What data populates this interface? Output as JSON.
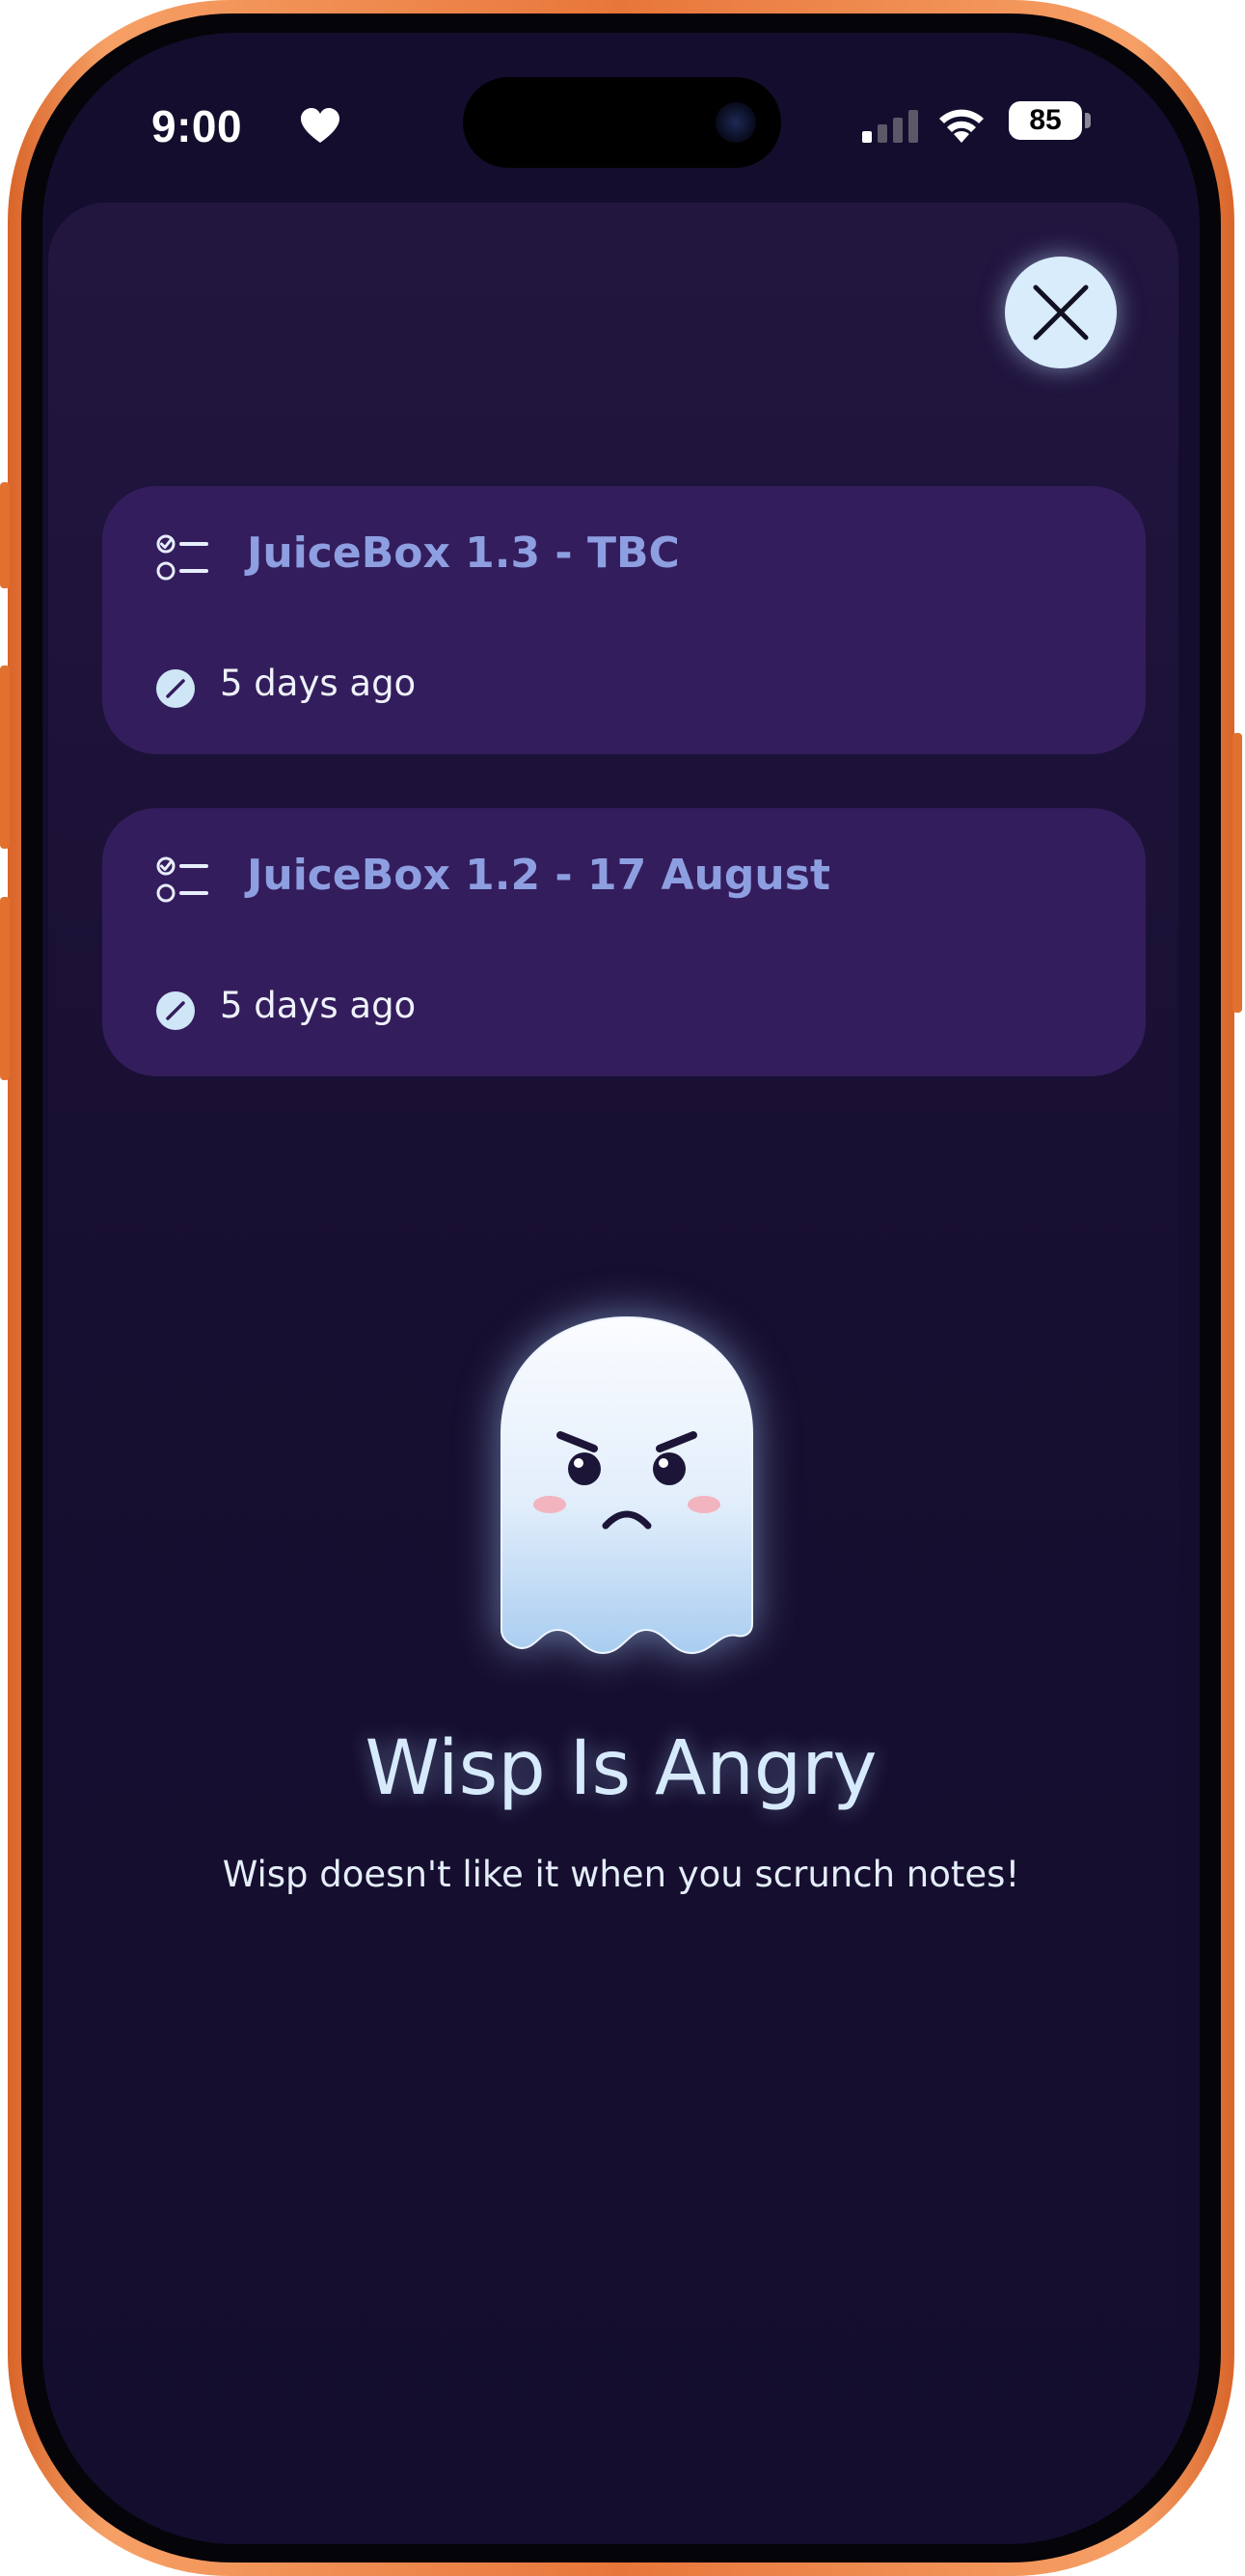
{
  "status_bar": {
    "time": "9:00",
    "battery": "85",
    "icons": [
      "heart-icon",
      "cellular-signal-icon",
      "wifi-icon",
      "battery-icon"
    ]
  },
  "sheet": {
    "close_icon": "close-icon"
  },
  "notes": [
    {
      "title": "JuiceBox 1.3 - TBC",
      "edited": "5 days ago",
      "icon": "checklist-icon",
      "meta_icon": "edit-pencil-icon"
    },
    {
      "title": "JuiceBox 1.2 - 17 August",
      "edited": "5 days ago",
      "icon": "checklist-icon",
      "meta_icon": "edit-pencil-icon"
    }
  ],
  "empty_state": {
    "illustration": "angry-ghost-icon",
    "title": "Wisp Is Angry",
    "subtitle": "Wisp doesn't like it when you scrunch notes!"
  },
  "colors": {
    "background": "#140d2d",
    "card": "#341d5c",
    "card_title": "#8d9fe1",
    "accent_light": "#d8ecfb",
    "phone_frame": "#e8763a"
  }
}
